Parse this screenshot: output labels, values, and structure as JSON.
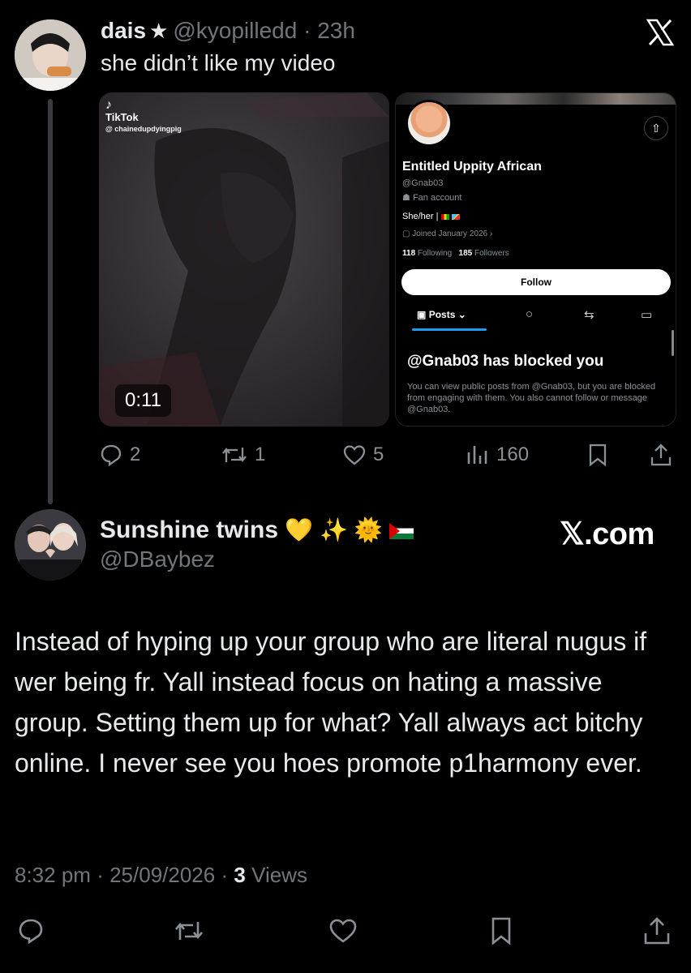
{
  "quoted_tweet": {
    "display_name": "dais",
    "handle": "@kyopilledd",
    "separator": "·",
    "time": "23h",
    "text": "she didn’t like my video",
    "media": {
      "tiktok_label": "TikTok",
      "tiktok_handle": "@ chainedupdyingpig",
      "duration": "0:11",
      "profile_screenshot": {
        "name": "Entitled Uppity African",
        "handle": "@Gnab03",
        "fan_label": "Fan account",
        "pronouns": "She/her |",
        "joined": "Joined January 2026",
        "following_count": "118",
        "following_label": "Following",
        "followers_count": "185",
        "followers_label": "Followers",
        "follow_button": "Follow",
        "tab_posts": "Posts",
        "blocked_title": "@Gnab03 has blocked you",
        "blocked_desc": "You can view public posts from @Gnab03, but you are blocked from engaging with them. You also cannot follow or message @Gnab03."
      }
    },
    "actions": {
      "replies": "2",
      "reposts": "1",
      "likes": "5",
      "views": "160"
    }
  },
  "main_tweet": {
    "display_name": "Sunshine twins",
    "name_emojis": "💛 ✨ 🌞",
    "handle": "@DBaybez",
    "brand": "𝕏.com",
    "text": "Instead of hyping up your group who are literal nugus if wer being fr. Yall instead focus on hating a massive group. Setting them up for what? Yall always act bitchy online. I never see you hoes promote p1harmony ever.",
    "time": "8:32 pm",
    "sep": "·",
    "date": "25/09/2026",
    "views_count": "3",
    "views_label": "Views"
  },
  "icons": [
    "reply-icon",
    "repost-icon",
    "like-icon",
    "views-icon",
    "bookmark-icon",
    "share-icon",
    "x-logo-icon"
  ],
  "colors": {
    "background": "#000000",
    "text_primary": "#e7e9ea",
    "text_muted": "#71767b",
    "accent_blue": "#1d9bf0"
  }
}
